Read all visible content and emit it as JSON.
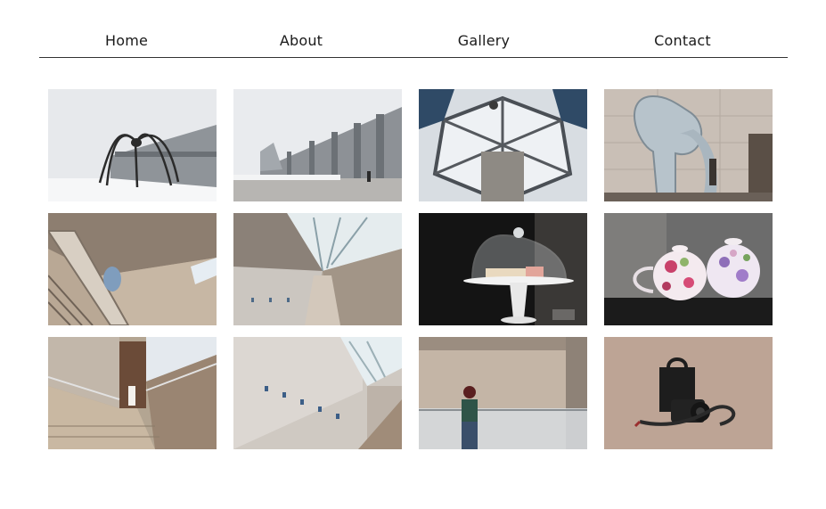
{
  "nav": {
    "home": "Home",
    "about": "About",
    "gallery": "Gallery",
    "contact": "Contact"
  },
  "gallery": {
    "photos": [
      {
        "subject": "spider-sculpture-in-snow"
      },
      {
        "subject": "museum-facade-winter"
      },
      {
        "subject": "glass-dome-ceiling"
      },
      {
        "subject": "curved-sculpture-indoor"
      },
      {
        "subject": "diagonal-staircase"
      },
      {
        "subject": "long-ramp-skylight"
      },
      {
        "subject": "cake-stand-glass-dome"
      },
      {
        "subject": "floral-teapots"
      },
      {
        "subject": "ramp-corridor-view"
      },
      {
        "subject": "stair-hall-skylight"
      },
      {
        "subject": "person-at-railing"
      },
      {
        "subject": "camera-bag-on-floor"
      }
    ]
  }
}
